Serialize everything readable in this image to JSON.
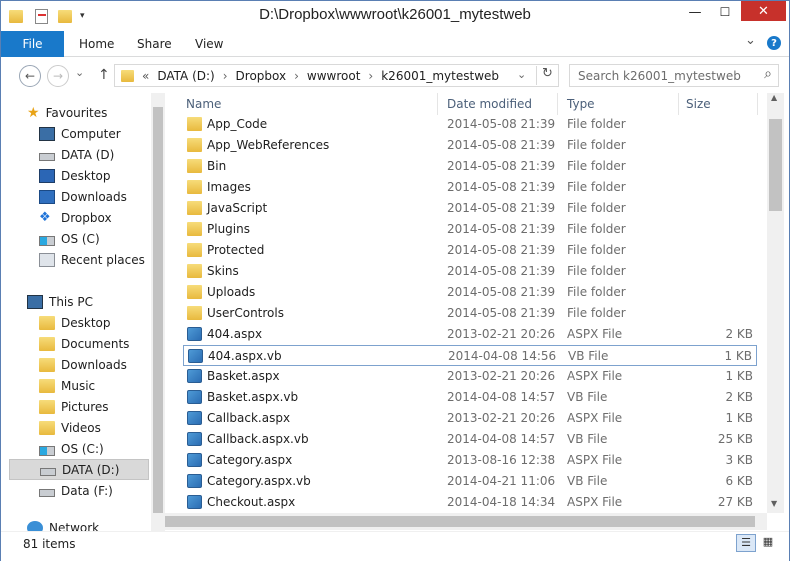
{
  "window": {
    "title": "D:\\Dropbox\\wwwroot\\k26001_mytestweb",
    "minimize": "—",
    "maximize": "☐",
    "close": "✕",
    "help": "?",
    "expand": "⌄"
  },
  "ribbon": {
    "file": "File",
    "tabs": [
      "Home",
      "Share",
      "View"
    ]
  },
  "address": {
    "prefix": "«",
    "crumbs": [
      "DATA (D:)",
      "Dropbox",
      "wwwroot",
      "k26001_mytestweb"
    ],
    "sep": "›",
    "refresh": "↻",
    "dropdown": "⌄"
  },
  "search": {
    "placeholder": "Search k26001_mytestweb",
    "icon": "⌕"
  },
  "nav_arrows": {
    "back": "←",
    "forward": "→",
    "down": "⌄",
    "up": "↑"
  },
  "sidebar": {
    "favourites": "Favourites",
    "fav_items": [
      "Computer",
      "DATA (D)",
      "Desktop",
      "Downloads",
      "Dropbox",
      "OS (C)",
      "Recent places"
    ],
    "thispc": "This PC",
    "pc_items": [
      "Desktop",
      "Documents",
      "Downloads",
      "Music",
      "Pictures",
      "Videos",
      "OS (C:)",
      "DATA (D:)",
      "Data (F:)"
    ],
    "network": "Network"
  },
  "columns": {
    "name": "Name",
    "date": "Date modified",
    "type": "Type",
    "size": "Size",
    "sort_arrow": "^"
  },
  "files": [
    {
      "name": "App_Code",
      "date": "2014-05-08 21:39",
      "type": "File folder",
      "size": "",
      "kind": "folder"
    },
    {
      "name": "App_WebReferences",
      "date": "2014-05-08 21:39",
      "type": "File folder",
      "size": "",
      "kind": "folder"
    },
    {
      "name": "Bin",
      "date": "2014-05-08 21:39",
      "type": "File folder",
      "size": "",
      "kind": "folder"
    },
    {
      "name": "Images",
      "date": "2014-05-08 21:39",
      "type": "File folder",
      "size": "",
      "kind": "folder"
    },
    {
      "name": "JavaScript",
      "date": "2014-05-08 21:39",
      "type": "File folder",
      "size": "",
      "kind": "folder"
    },
    {
      "name": "Plugins",
      "date": "2014-05-08 21:39",
      "type": "File folder",
      "size": "",
      "kind": "folder"
    },
    {
      "name": "Protected",
      "date": "2014-05-08 21:39",
      "type": "File folder",
      "size": "",
      "kind": "folder"
    },
    {
      "name": "Skins",
      "date": "2014-05-08 21:39",
      "type": "File folder",
      "size": "",
      "kind": "folder"
    },
    {
      "name": "Uploads",
      "date": "2014-05-08 21:39",
      "type": "File folder",
      "size": "",
      "kind": "folder"
    },
    {
      "name": "UserControls",
      "date": "2014-05-08 21:39",
      "type": "File folder",
      "size": "",
      "kind": "folder"
    },
    {
      "name": "404.aspx",
      "date": "2013-02-21 20:26",
      "type": "ASPX File",
      "size": "2 KB",
      "kind": "file"
    },
    {
      "name": "404.aspx.vb",
      "date": "2014-04-08 14:56",
      "type": "VB File",
      "size": "1 KB",
      "kind": "file"
    },
    {
      "name": "Basket.aspx",
      "date": "2013-02-21 20:26",
      "type": "ASPX File",
      "size": "1 KB",
      "kind": "file"
    },
    {
      "name": "Basket.aspx.vb",
      "date": "2014-04-08 14:57",
      "type": "VB File",
      "size": "2 KB",
      "kind": "file"
    },
    {
      "name": "Callback.aspx",
      "date": "2013-02-21 20:26",
      "type": "ASPX File",
      "size": "1 KB",
      "kind": "file"
    },
    {
      "name": "Callback.aspx.vb",
      "date": "2014-04-08 14:57",
      "type": "VB File",
      "size": "25 KB",
      "kind": "file"
    },
    {
      "name": "Category.aspx",
      "date": "2013-08-16 12:38",
      "type": "ASPX File",
      "size": "3 KB",
      "kind": "file"
    },
    {
      "name": "Category.aspx.vb",
      "date": "2014-04-21 11:06",
      "type": "VB File",
      "size": "6 KB",
      "kind": "file"
    },
    {
      "name": "Checkout.aspx",
      "date": "2014-04-18 14:34",
      "type": "ASPX File",
      "size": "27 KB",
      "kind": "file"
    }
  ],
  "selected_index": 11,
  "status": {
    "count": "81 items"
  },
  "colors": {
    "accent": "#1979ca",
    "selection_border": "#7da2ce"
  }
}
